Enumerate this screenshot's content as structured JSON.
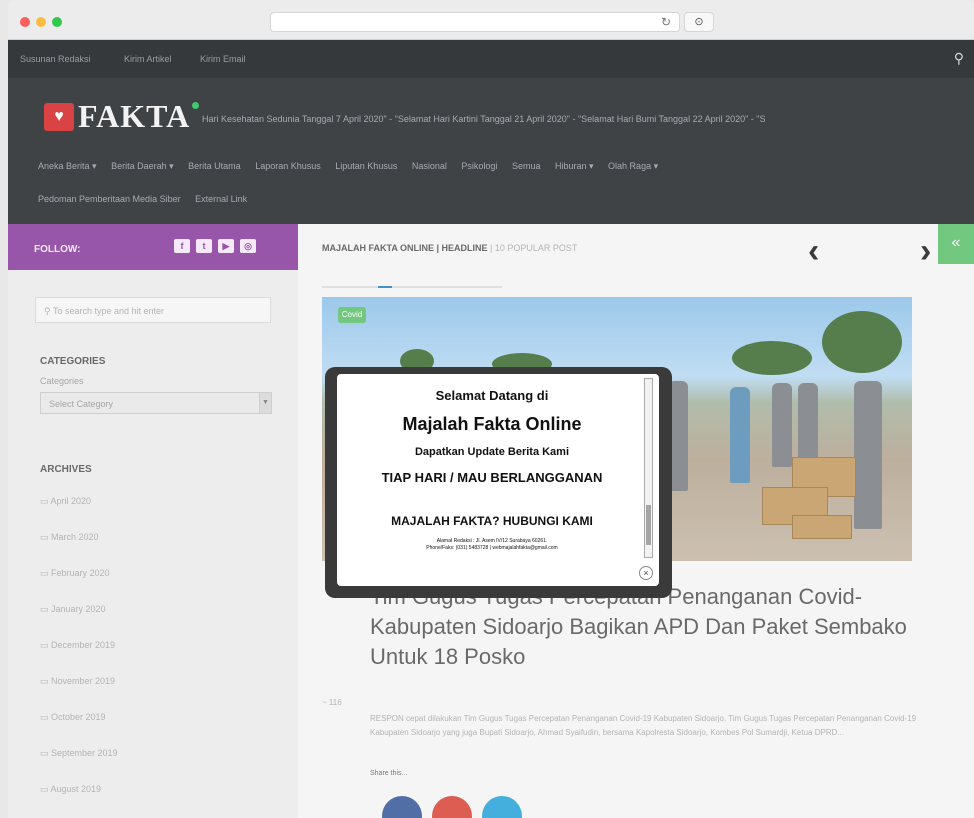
{
  "topbar": {
    "links": [
      "Susunan Redaksi",
      "Kirim Artikel",
      "Kirim Email"
    ]
  },
  "logo": {
    "text": "FAKTA"
  },
  "ticker": {
    "text": "Hari Kesehatan Sedunia Tanggal 7 April 2020\" - \"Selamat Hari Kartini Tanggal 21 April 2020\" - \"Selamat Hari Bumi Tanggal 22 April 2020\" - \"S"
  },
  "nav": {
    "items": [
      "Aneka Berita ▾",
      "Berita Daerah ▾",
      "Berita Utama",
      "Laporan Khusus",
      "Liputan Khusus",
      "Nasional",
      "Psikologi",
      "Semua",
      "Hiburan ▾",
      "Olah Raga ▾",
      "Pedoman Pemberitaan Media Siber",
      "External Link"
    ]
  },
  "sidebar": {
    "follow_label": "FOLLOW:",
    "search_placeholder": "To search type and hit enter",
    "categories_title": "CATEGORIES",
    "categories_sub": "Categories",
    "select_value": "Select Category",
    "archives_title": "ARCHIVES",
    "archives": [
      "April 2020",
      "March 2020",
      "February 2020",
      "January 2020",
      "December 2019",
      "November 2019",
      "October 2019",
      "September 2019",
      "August 2019"
    ]
  },
  "content": {
    "head_label": "MAJALAH FAKTA ONLINE | HEADLINE",
    "head_label_light": " | 10 POPULAR POST",
    "tag": "Covid",
    "article_title": "Tim Gugus Tugas Percepatan Penanganan Covid-Kabupaten Sidoarjo Bagikan APD Dan Paket Sembako Untuk 18 Posko",
    "count": "~ 116",
    "excerpt": "RESPON cepat dilakukan Tim Gugus Tugas Percepatan Penanganan Covid-19 Kabupaten Sidoarjo. Tim Gugus Tugas Percepatan Penanganan Covid-19 Kabupaten Sidoarjo yang juga Bupati Sidoarjo, Ahmad Syaifudin, bersama Kapolresta Sidoarjo, Kombes Pol Sumardji, Ketua DPRD...",
    "share_label": "Share this..."
  },
  "modal": {
    "line1": "Selamat Datang di",
    "line2": "Majalah Fakta Online",
    "line3": "Dapatkan Update Berita Kami",
    "line4": "TIAP HARI / MAU BERLANGGANAN",
    "line5": "MAJALAH FAKTA? HUBUNGI KAMI",
    "line6": "Alamat Redaksi : Jl. Asem IV/12 Surabaya 60261.",
    "line7": "Phone/Faks: (031) 5483728 | webmajalahfakta@gmail.com",
    "close": "×"
  },
  "colors": {
    "accent_purple": "#8a3fa0",
    "accent_green": "#5fc16e",
    "logo_red": "#d42a2a"
  }
}
